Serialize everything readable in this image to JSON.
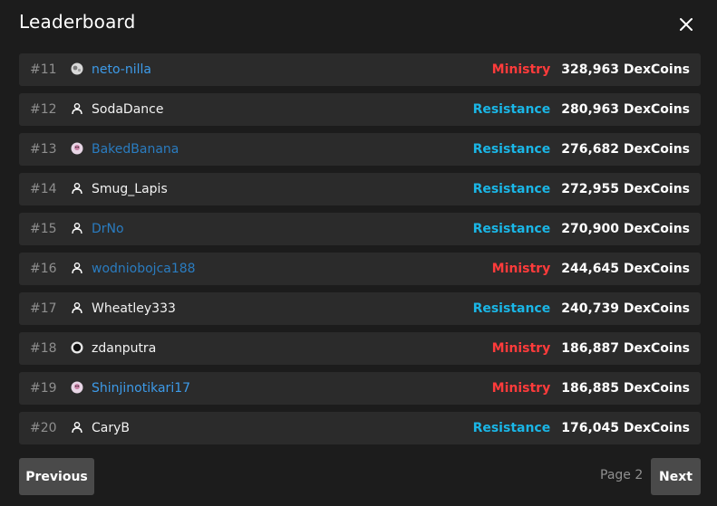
{
  "title": "Leaderboard",
  "rows": [
    {
      "rank": "#11",
      "name": "neto-nilla",
      "name_color": "blue",
      "avatar": "globe-avatar-icon",
      "faction": "Ministry",
      "faction_type": "ministry",
      "coins": "328,963 DexCoins"
    },
    {
      "rank": "#12",
      "name": "SodaDance",
      "name_color": "white",
      "avatar": "user-icon",
      "faction": "Resistance",
      "faction_type": "resistance",
      "coins": "280,963 DexCoins"
    },
    {
      "rank": "#13",
      "name": "BakedBanana",
      "name_color": "dimblue",
      "avatar": "character-avatar-icon",
      "faction": "Resistance",
      "faction_type": "resistance",
      "coins": "276,682 DexCoins"
    },
    {
      "rank": "#14",
      "name": "Smug_Lapis",
      "name_color": "white",
      "avatar": "user-icon",
      "faction": "Resistance",
      "faction_type": "resistance",
      "coins": "272,955 DexCoins"
    },
    {
      "rank": "#15",
      "name": "DrNo",
      "name_color": "dimblue",
      "avatar": "user-icon",
      "faction": "Resistance",
      "faction_type": "resistance",
      "coins": "270,900 DexCoins"
    },
    {
      "rank": "#16",
      "name": "wodniobojca188",
      "name_color": "dimblue",
      "avatar": "user-icon",
      "faction": "Ministry",
      "faction_type": "ministry",
      "coins": "244,645 DexCoins"
    },
    {
      "rank": "#17",
      "name": "Wheatley333",
      "name_color": "white",
      "avatar": "user-icon",
      "faction": "Resistance",
      "faction_type": "resistance",
      "coins": "240,739 DexCoins"
    },
    {
      "rank": "#18",
      "name": "zdanputra",
      "name_color": "white",
      "avatar": "dark-avatar-icon",
      "faction": "Ministry",
      "faction_type": "ministry",
      "coins": "186,887 DexCoins"
    },
    {
      "rank": "#19",
      "name": "Shinjinotikari17",
      "name_color": "blue",
      "avatar": "character-avatar-icon",
      "faction": "Ministry",
      "faction_type": "ministry",
      "coins": "186,885 DexCoins"
    },
    {
      "rank": "#20",
      "name": "CaryB",
      "name_color": "white",
      "avatar": "user-icon",
      "faction": "Resistance",
      "faction_type": "resistance",
      "coins": "176,045 DexCoins"
    }
  ],
  "pagination": {
    "previous_label": "Previous",
    "page_label": "Page 2",
    "next_label": "Next"
  },
  "colors": {
    "ministry": "#ff3b3b",
    "resistance": "#1ab6e6",
    "background": "#1c1c1c",
    "row_background": "#2b2b2b"
  }
}
